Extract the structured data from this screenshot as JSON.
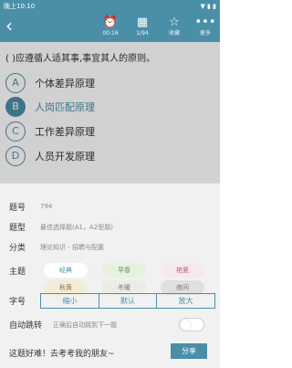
{
  "status_bar": {
    "time": "晚上10:10",
    "right": "▼ ▮ ▮"
  },
  "toolbar": {
    "back_icon": "back-arrow",
    "timer": {
      "icon": "alarm-clock",
      "label": "00:16"
    },
    "progress": {
      "icon": "grid",
      "label": "1/94"
    },
    "favorite": {
      "icon": "star",
      "label": "收藏"
    },
    "more": {
      "icon": "more",
      "label": "更多"
    }
  },
  "question": {
    "text": "( )应遵循人适其事,事宜其人的原则。"
  },
  "options": [
    {
      "letter": "A",
      "text": "个体差异原理",
      "selected": false
    },
    {
      "letter": "B",
      "text": "人岗匹配原理",
      "selected": true
    },
    {
      "letter": "C",
      "text": "工作差异原理",
      "selected": false
    },
    {
      "letter": "D",
      "text": "人员开发原理",
      "selected": false
    }
  ],
  "info": {
    "number_label": "题号",
    "number_value": "794",
    "type_label": "题型",
    "type_value": "最佳选择题(A1，A2型题)",
    "category_label": "分类",
    "category_value": "理论知识 - 招聘与配置"
  },
  "theme": {
    "label": "主题",
    "options": [
      {
        "name": "经典",
        "bg": "#ffffff",
        "color": "#4a8fa8"
      },
      {
        "name": "早春",
        "bg": "#e6f2df",
        "color": "#6a9a5a"
      },
      {
        "name": "艳夏",
        "bg": "#f7e8ec",
        "color": "#b06a80"
      },
      {
        "name": "秋黄",
        "bg": "#f2ecd8",
        "color": "#8a7a50"
      },
      {
        "name": "冬暖",
        "bg": "#ecece6",
        "color": "#777777"
      },
      {
        "name": "夜间",
        "bg": "#e0e0e0",
        "color": "#777777"
      }
    ]
  },
  "font": {
    "label": "字号",
    "small": "缩小",
    "default": "默认",
    "large": "放大"
  },
  "auto_jump": {
    "label": "自动跳转",
    "description": "正确后自动跳到下一题",
    "enabled": false
  },
  "share": {
    "text": "这题好难！去考考我的朋友~",
    "button": "分享"
  },
  "colors": {
    "accent": "#4a8fa8"
  }
}
